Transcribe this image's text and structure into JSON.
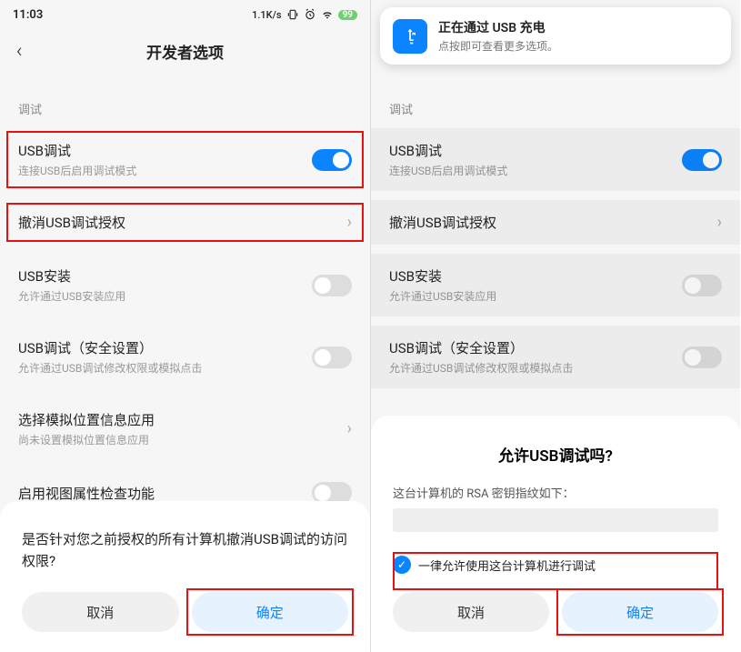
{
  "statusbar": {
    "time": "11:03",
    "speed": "1.1K/s",
    "battery": "99"
  },
  "page_title": "开发者选项",
  "section_label": "调试",
  "items": {
    "usb_debug": {
      "title": "USB调试",
      "subtitle": "连接USB后启用调试模式"
    },
    "revoke": {
      "title": "撤消USB调试授权"
    },
    "usb_install": {
      "title": "USB安装",
      "subtitle": "允许通过USB安装应用"
    },
    "usb_secure": {
      "title": "USB调试（安全设置）",
      "subtitle": "允许通过USB调试修改权限或模拟点击"
    },
    "mock_location": {
      "title": "选择模拟位置信息应用",
      "subtitle": "尚未设置模拟位置信息应用"
    },
    "view_attr": {
      "title": "启用视图属性检查功能"
    }
  },
  "sheet1": {
    "message": "是否针对您之前授权的所有计算机撤消USB调试的访问权限?",
    "cancel": "取消",
    "confirm": "确定"
  },
  "notification": {
    "title": "正在通过 USB 充电",
    "subtitle": "点按即可查看更多选项。"
  },
  "sheet2": {
    "title": "允许USB调试吗?",
    "fingerprint_label": "这台计算机的 RSA 密钥指纹如下：",
    "always_allow": "一律允许使用这台计算机进行调试",
    "cancel": "取消",
    "confirm": "确定"
  }
}
